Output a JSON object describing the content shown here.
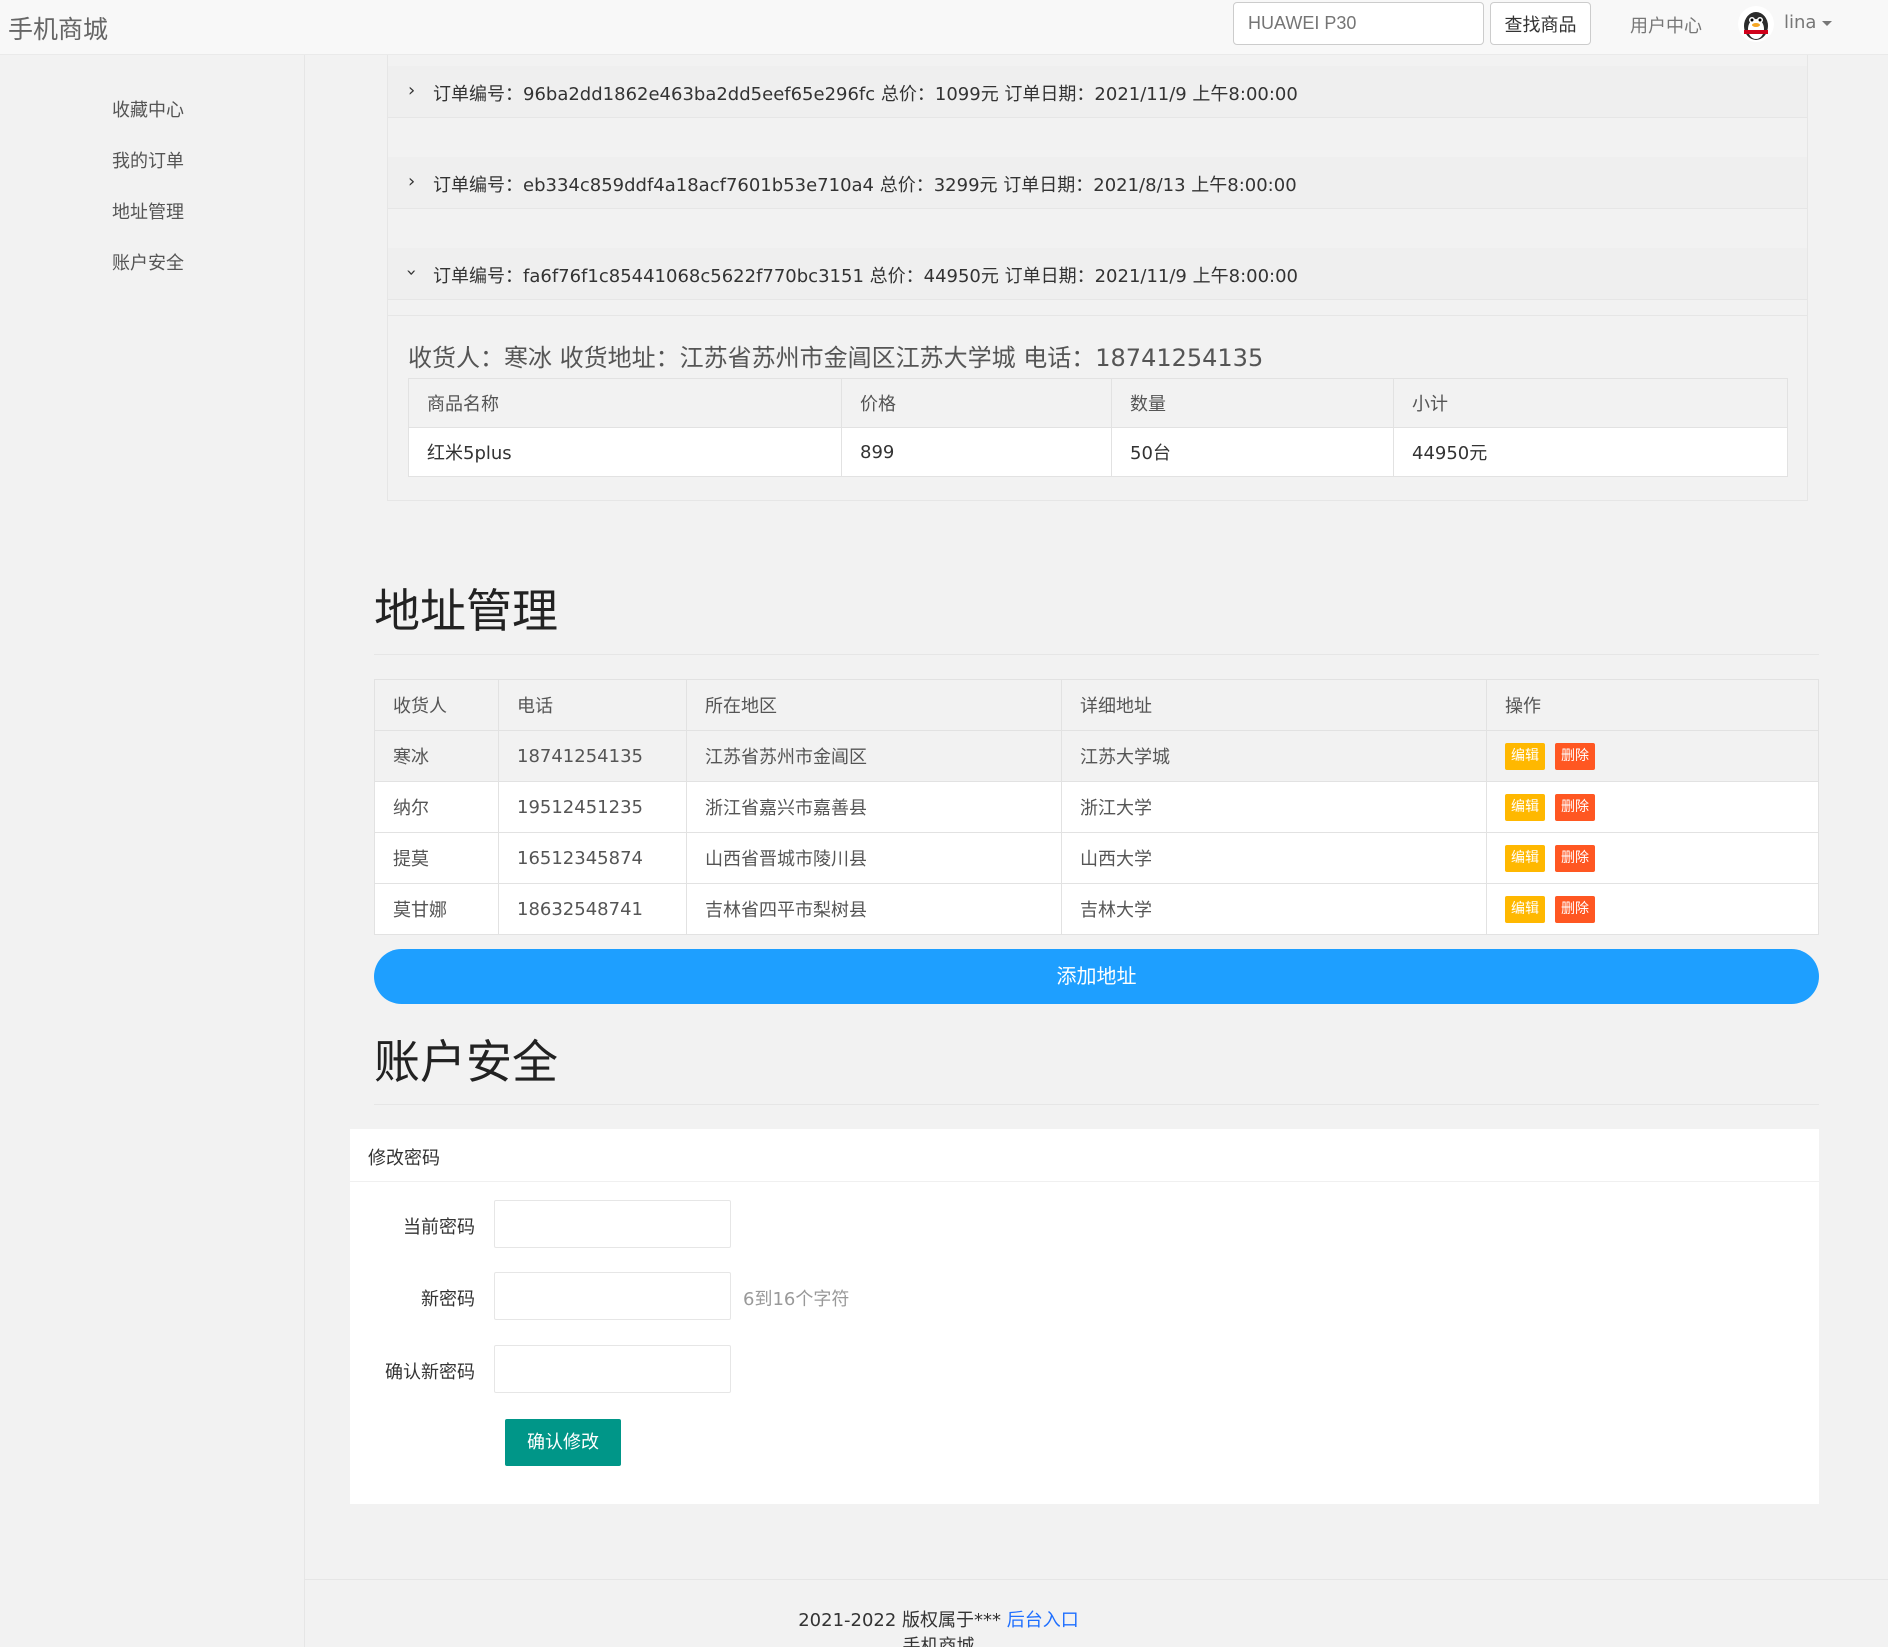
{
  "nav": {
    "brand": "手机商城",
    "search_placeholder": "HUAWEI P30",
    "search_button": "查找商品",
    "user_center": "用户中心",
    "username": "lina",
    "avatar_icon": "penguin-avatar-icon"
  },
  "sidebar": {
    "items": [
      {
        "label": "收藏中心"
      },
      {
        "label": "我的订单"
      },
      {
        "label": "地址管理"
      },
      {
        "label": "账户安全"
      }
    ]
  },
  "orders": [
    {
      "text": "订单编号：96ba2dd1862e463ba2dd5eef65e296fc  总价：1099元 订单日期：2021/11/9 上午8:00:00",
      "expanded": false
    },
    {
      "text": "订单编号：eb334c859ddf4a18acf7601b53e710a4  总价：3299元 订单日期：2021/8/13 上午8:00:00",
      "expanded": false
    },
    {
      "text": "订单编号：fa6f76f1c85441068c5622f770bc3151  总价：44950元 订单日期：2021/11/9 上午8:00:00",
      "expanded": true
    }
  ],
  "order_detail": {
    "receiver_line": "收货人：寒冰  收货地址：江苏省苏州市金阊区江苏大学城 电话：18741254135",
    "headers": [
      "商品名称",
      "价格",
      "数量",
      "小计"
    ],
    "rows": [
      [
        "红米5plus",
        "899",
        "50台",
        "44950元"
      ]
    ]
  },
  "address": {
    "title": "地址管理",
    "headers": [
      "收货人",
      "电话",
      "所在地区",
      "详细地址",
      "操作"
    ],
    "rows": [
      {
        "name": "寒冰",
        "phone": "18741254135",
        "region": "江苏省苏州市金阊区",
        "detail": "江苏大学城"
      },
      {
        "name": "纳尔",
        "phone": "19512451235",
        "region": "浙江省嘉兴市嘉善县",
        "detail": "浙江大学"
      },
      {
        "name": "提莫",
        "phone": "16512345874",
        "region": "山西省晋城市陵川县",
        "detail": "山西大学"
      },
      {
        "name": "莫甘娜",
        "phone": "18632548741",
        "region": "吉林省四平市梨树县",
        "detail": "吉林大学"
      }
    ],
    "edit_label": "编辑",
    "delete_label": "删除",
    "add_button": "添加地址"
  },
  "security": {
    "title": "账户安全",
    "card_title": "修改密码",
    "current_label": "当前密码",
    "new_label": "新密码",
    "new_hint": "6到16个字符",
    "confirm_label": "确认新密码",
    "confirm_button": "确认修改"
  },
  "footer": {
    "copyright": "2021-2022 版权属于*** ",
    "admin_link": "后台入口",
    "site_name": "手机商城"
  },
  "colors": {
    "primary_blue": "#1e9fff",
    "edit_yellow": "#ffb800",
    "delete_orange": "#ff5722",
    "confirm_teal": "#009688"
  }
}
